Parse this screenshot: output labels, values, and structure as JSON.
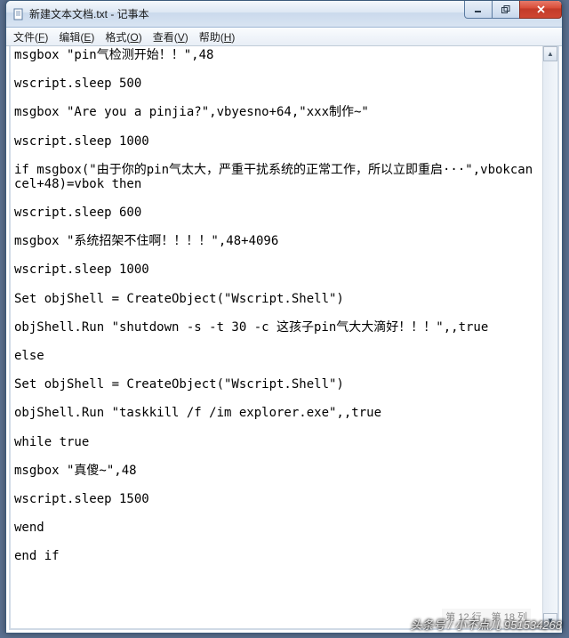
{
  "window": {
    "title": "新建文本文档.txt - 记事本"
  },
  "menu": {
    "file": "文件(F)",
    "edit": "编辑(E)",
    "format": "格式(O)",
    "view": "查看(V)",
    "help": "帮助(H)"
  },
  "editor": {
    "text": "msgbox \"pin气检测开始！！\",48\n\nwscript.sleep 500\n\nmsgbox \"Are you a pinjia?\",vbyesno+64,\"xxx制作~\"\n\nwscript.sleep 1000\n\nif msgbox(\"由于你的pin气太大，严重干扰系统的正常工作，所以立即重启···\",vbokcancel+48)=vbok then\n\nwscript.sleep 600\n\nmsgbox \"系统招架不住啊！！！！\",48+4096\n\nwscript.sleep 1000\n\nSet objShell = CreateObject(\"Wscript.Shell\")\n\nobjShell.Run \"shutdown -s -t 30 -c 这孩子pin气大大滴好！！！\",,true\n\nelse\n\nSet objShell = CreateObject(\"Wscript.Shell\")\n\nobjShell.Run \"taskkill /f /im explorer.exe\",,true\n\nwhile true\n\nmsgbox \"真傻~\",48\n\nwscript.sleep 1500\n\nwend\n\nend if"
  },
  "status": {
    "pos": "第 12 行，第 18 列"
  },
  "watermark": "头条号 / 小不点儿 951534268"
}
